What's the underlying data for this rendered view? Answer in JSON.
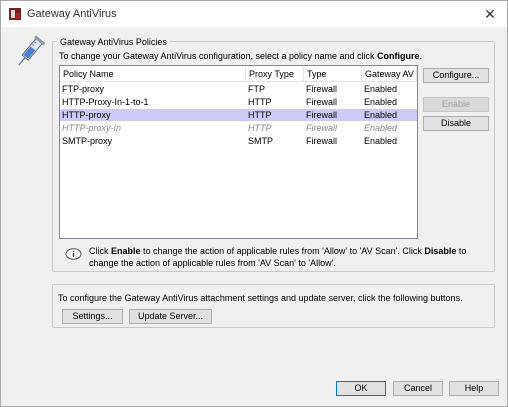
{
  "window": {
    "title": "Gateway AntiVirus",
    "close_glyph": "✕"
  },
  "icons": {
    "app": "shield-app-icon",
    "banner": "syringe-icon",
    "info": "info-icon"
  },
  "policies": {
    "legend": "Gateway AntiVirus Policies",
    "instruction_prefix": "To change your Gateway AntiVirus configuration, select a policy name and click ",
    "instruction_bold": "Configure",
    "instruction_suffix": ".",
    "columns": [
      "Policy Name",
      "Proxy Type",
      "Type",
      "Gateway AV"
    ],
    "rows": [
      {
        "name": "FTP-proxy",
        "proxy_type": "FTP",
        "type": "Firewall",
        "status": "Enabled"
      },
      {
        "name": "HTTP-Proxy-In-1-to-1",
        "proxy_type": "HTTP",
        "type": "Firewall",
        "status": "Enabled"
      },
      {
        "name": "HTTP-proxy",
        "proxy_type": "HTTP",
        "type": "Firewall",
        "status": "Enabled"
      },
      {
        "name": "HTTP-proxy-In",
        "proxy_type": "HTTP",
        "type": "Firewall",
        "status": "Enabled"
      },
      {
        "name": "SMTP-proxy",
        "proxy_type": "SMTP",
        "type": "Firewall",
        "status": "Enabled"
      }
    ],
    "selected_row": 2,
    "disabled_row": 3,
    "buttons": {
      "configure": "Configure...",
      "enable": "Enable",
      "disable": "Disable"
    },
    "info": {
      "p1": "Click ",
      "b1": "Enable",
      "p2": " to change the action of applicable rules from 'Allow' to 'AV Scan'. Click ",
      "b2": "Disable",
      "p3": " to change the action of applicable rules from 'AV Scan' to 'Allow'."
    }
  },
  "settings": {
    "text": "To configure the Gateway AntiVirus attachment settings and update server, click the following buttons.",
    "settings_button": "Settings...",
    "update_server_button": "Update Server..."
  },
  "footer": {
    "ok": "OK",
    "cancel": "Cancel",
    "help": "Help"
  },
  "colors": {
    "selection": "#cccbf7",
    "default_button_border": "#0078d7"
  }
}
